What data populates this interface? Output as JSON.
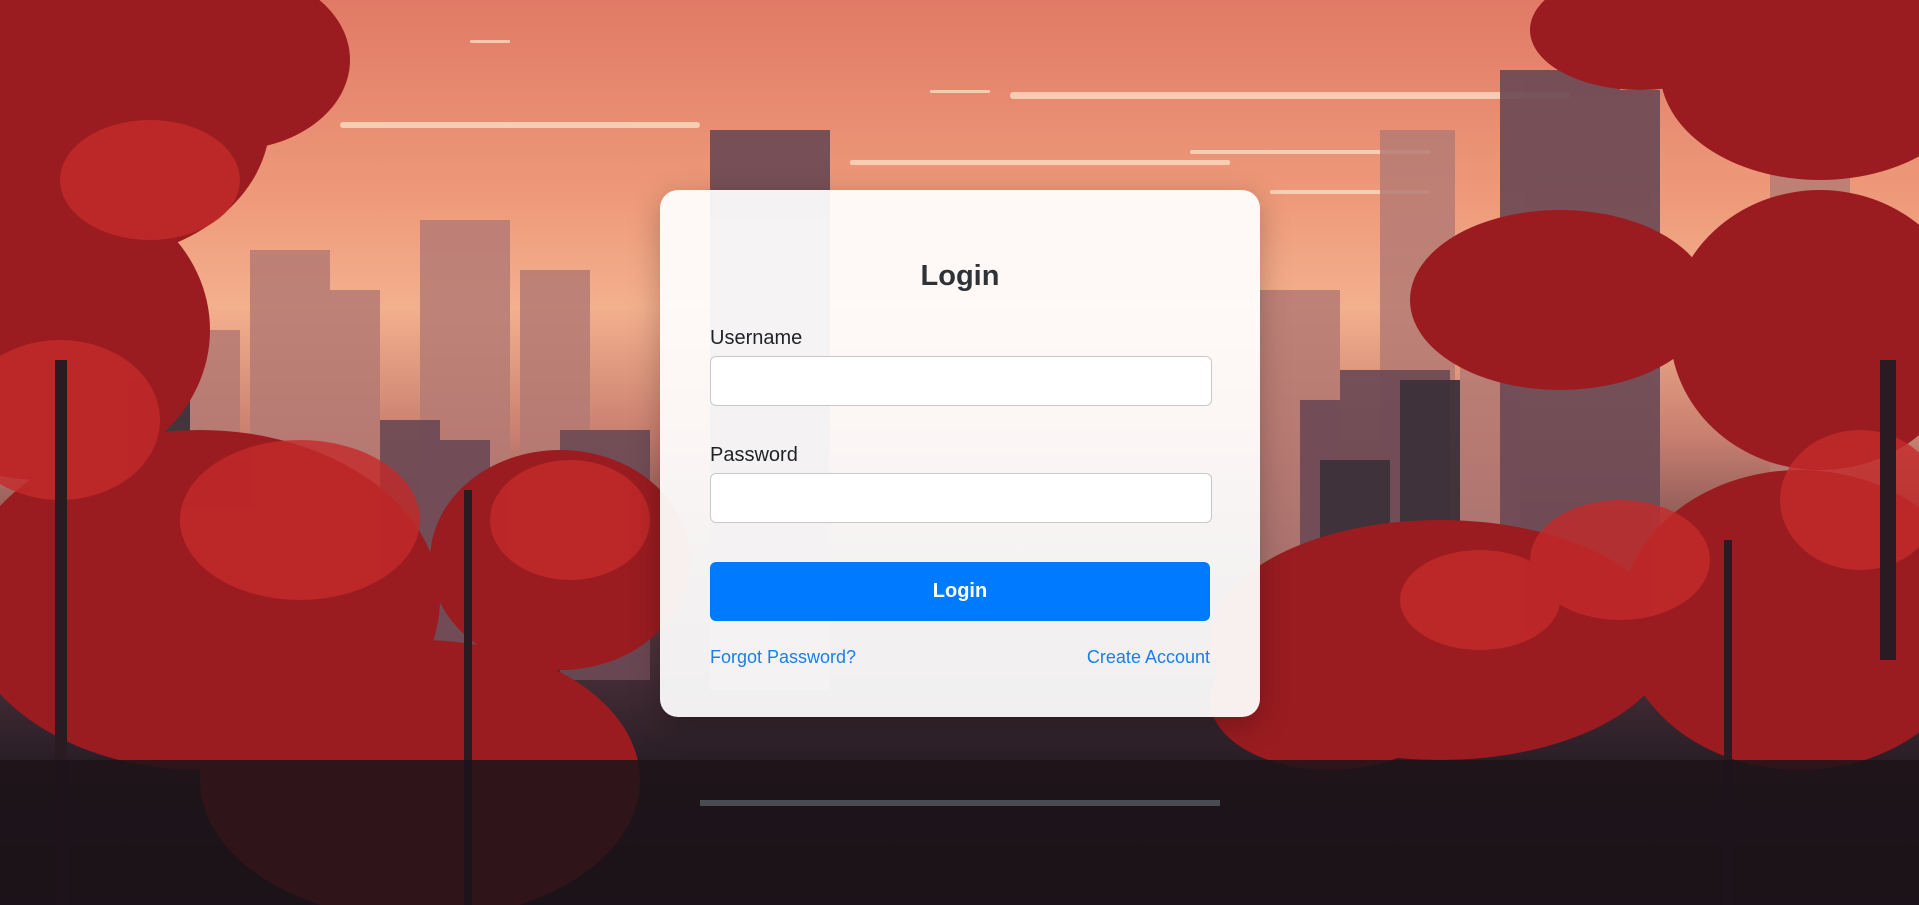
{
  "form": {
    "title": "Login",
    "username_label": "Username",
    "username_value": "",
    "password_label": "Password",
    "password_value": "",
    "submit_label": "Login",
    "forgot_link": "Forgot Password?",
    "create_link": "Create Account"
  },
  "colors": {
    "primary_button": "#007bff",
    "link": "#1a7fe8",
    "card_background": "#f6f6f6"
  }
}
